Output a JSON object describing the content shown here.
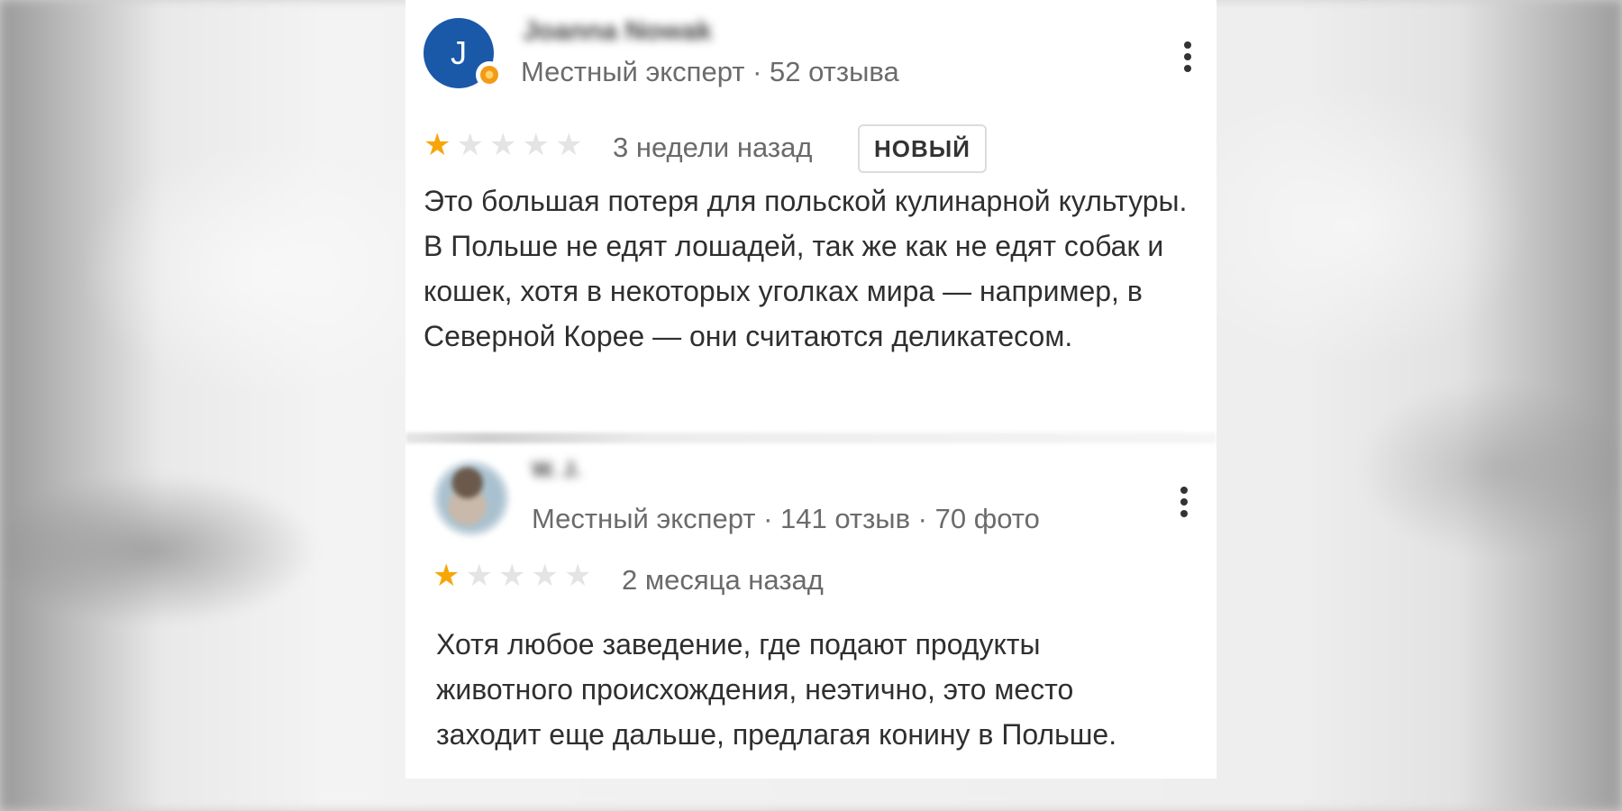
{
  "reviews": [
    {
      "avatar_letter": "J",
      "author": "Joanna Nowak",
      "meta": "Местный эксперт · 52 отзыва",
      "rating": 1,
      "time": "3 недели назад",
      "badge": "НОВЫЙ",
      "text": "Это большая потеря для польской кулинарной культуры. В Польше не едят лошадей, так же как не едят собак и кошек, хотя в некоторых уголках мира — например, в Северной Корее — они считаются деликатесом."
    },
    {
      "author": "W. J.",
      "meta": "Местный эксперт · 141 отзыв · 70 фото",
      "rating": 1,
      "time": "2 месяца назад",
      "text": "Хотя любое заведение, где подают продукты животного происхождения, неэтично, это место заходит еще дальше, предлагая конину в Польше."
    }
  ],
  "colors": {
    "star_filled": "#f6a609",
    "star_empty": "#e4e4e4",
    "avatar_bg": "#1a58a8"
  }
}
